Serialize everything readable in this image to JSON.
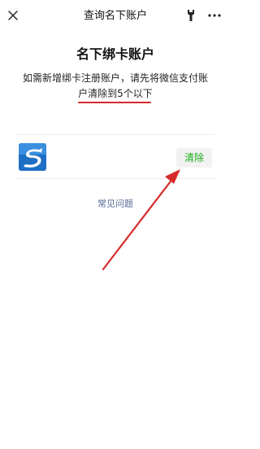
{
  "navbar": {
    "title": "查询名下账户",
    "close_icon": "close-icon",
    "tool_icon": "wrench-icon",
    "more_icon": "more-icon"
  },
  "main": {
    "heading": "名下绑卡账户",
    "note_line1": "如需新增绑卡注册账户，请先将微信支付账",
    "note_line2": "户清除到5个以下"
  },
  "account": {
    "logo_icon": "bank-logo-icon",
    "clear_label": "清除"
  },
  "footer": {
    "faq_label": "常见问题"
  },
  "colors": {
    "accent_green": "#1aad19",
    "link_blue": "#576b95",
    "annotation_red": "#d62a2a",
    "logo_blue": "#1f6fc5"
  }
}
